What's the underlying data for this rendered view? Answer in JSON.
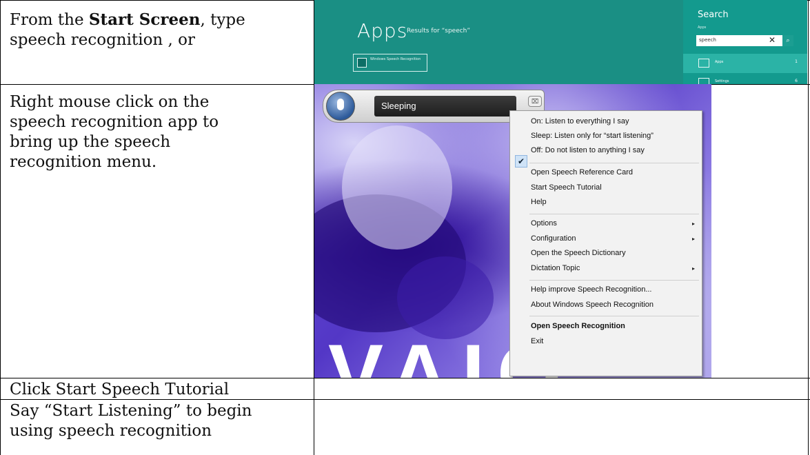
{
  "rows": {
    "r1": {
      "prefix": "From the ",
      "bold": "Start Screen",
      "suffix": ", type",
      "line2": "speech recognition , or"
    },
    "r2": {
      "lines": [
        "Right mouse click on the",
        "speech recognition app to",
        "bring up the speech",
        "recognition menu."
      ]
    },
    "r3": {
      "text": "Click Start Speech Tutorial"
    },
    "r4": {
      "line1": "Say “Start Listening” to begin",
      "line2": "using speech recognition"
    }
  },
  "shot1": {
    "title": "Apps",
    "subtitle": "Results for “speech”",
    "tile_label": "Windows Speech Recognition",
    "panel_title": "Search",
    "panel_apps": "Apps",
    "query": "speech",
    "clear": "✕",
    "go": "⌕",
    "rows": [
      {
        "label": "Apps",
        "count": "1"
      },
      {
        "label": "Settings",
        "count": "6"
      }
    ]
  },
  "shot2": {
    "status": "Sleeping",
    "close": "⌧",
    "checkmark": "✔",
    "submenu_arrow": "▸",
    "logo_text": "VAIO",
    "menu": [
      "On: Listen to everything I say",
      "Sleep: Listen only for “start listening”",
      "Off: Do not listen to anything I say",
      "Open Speech Reference Card",
      "Start Speech Tutorial",
      "Help",
      "Options",
      "Configuration",
      "Open the Speech Dictionary",
      "Dictation Topic",
      "Help improve Speech Recognition...",
      "About Windows Speech Recognition",
      "Open Speech Recognition",
      "Exit"
    ]
  }
}
